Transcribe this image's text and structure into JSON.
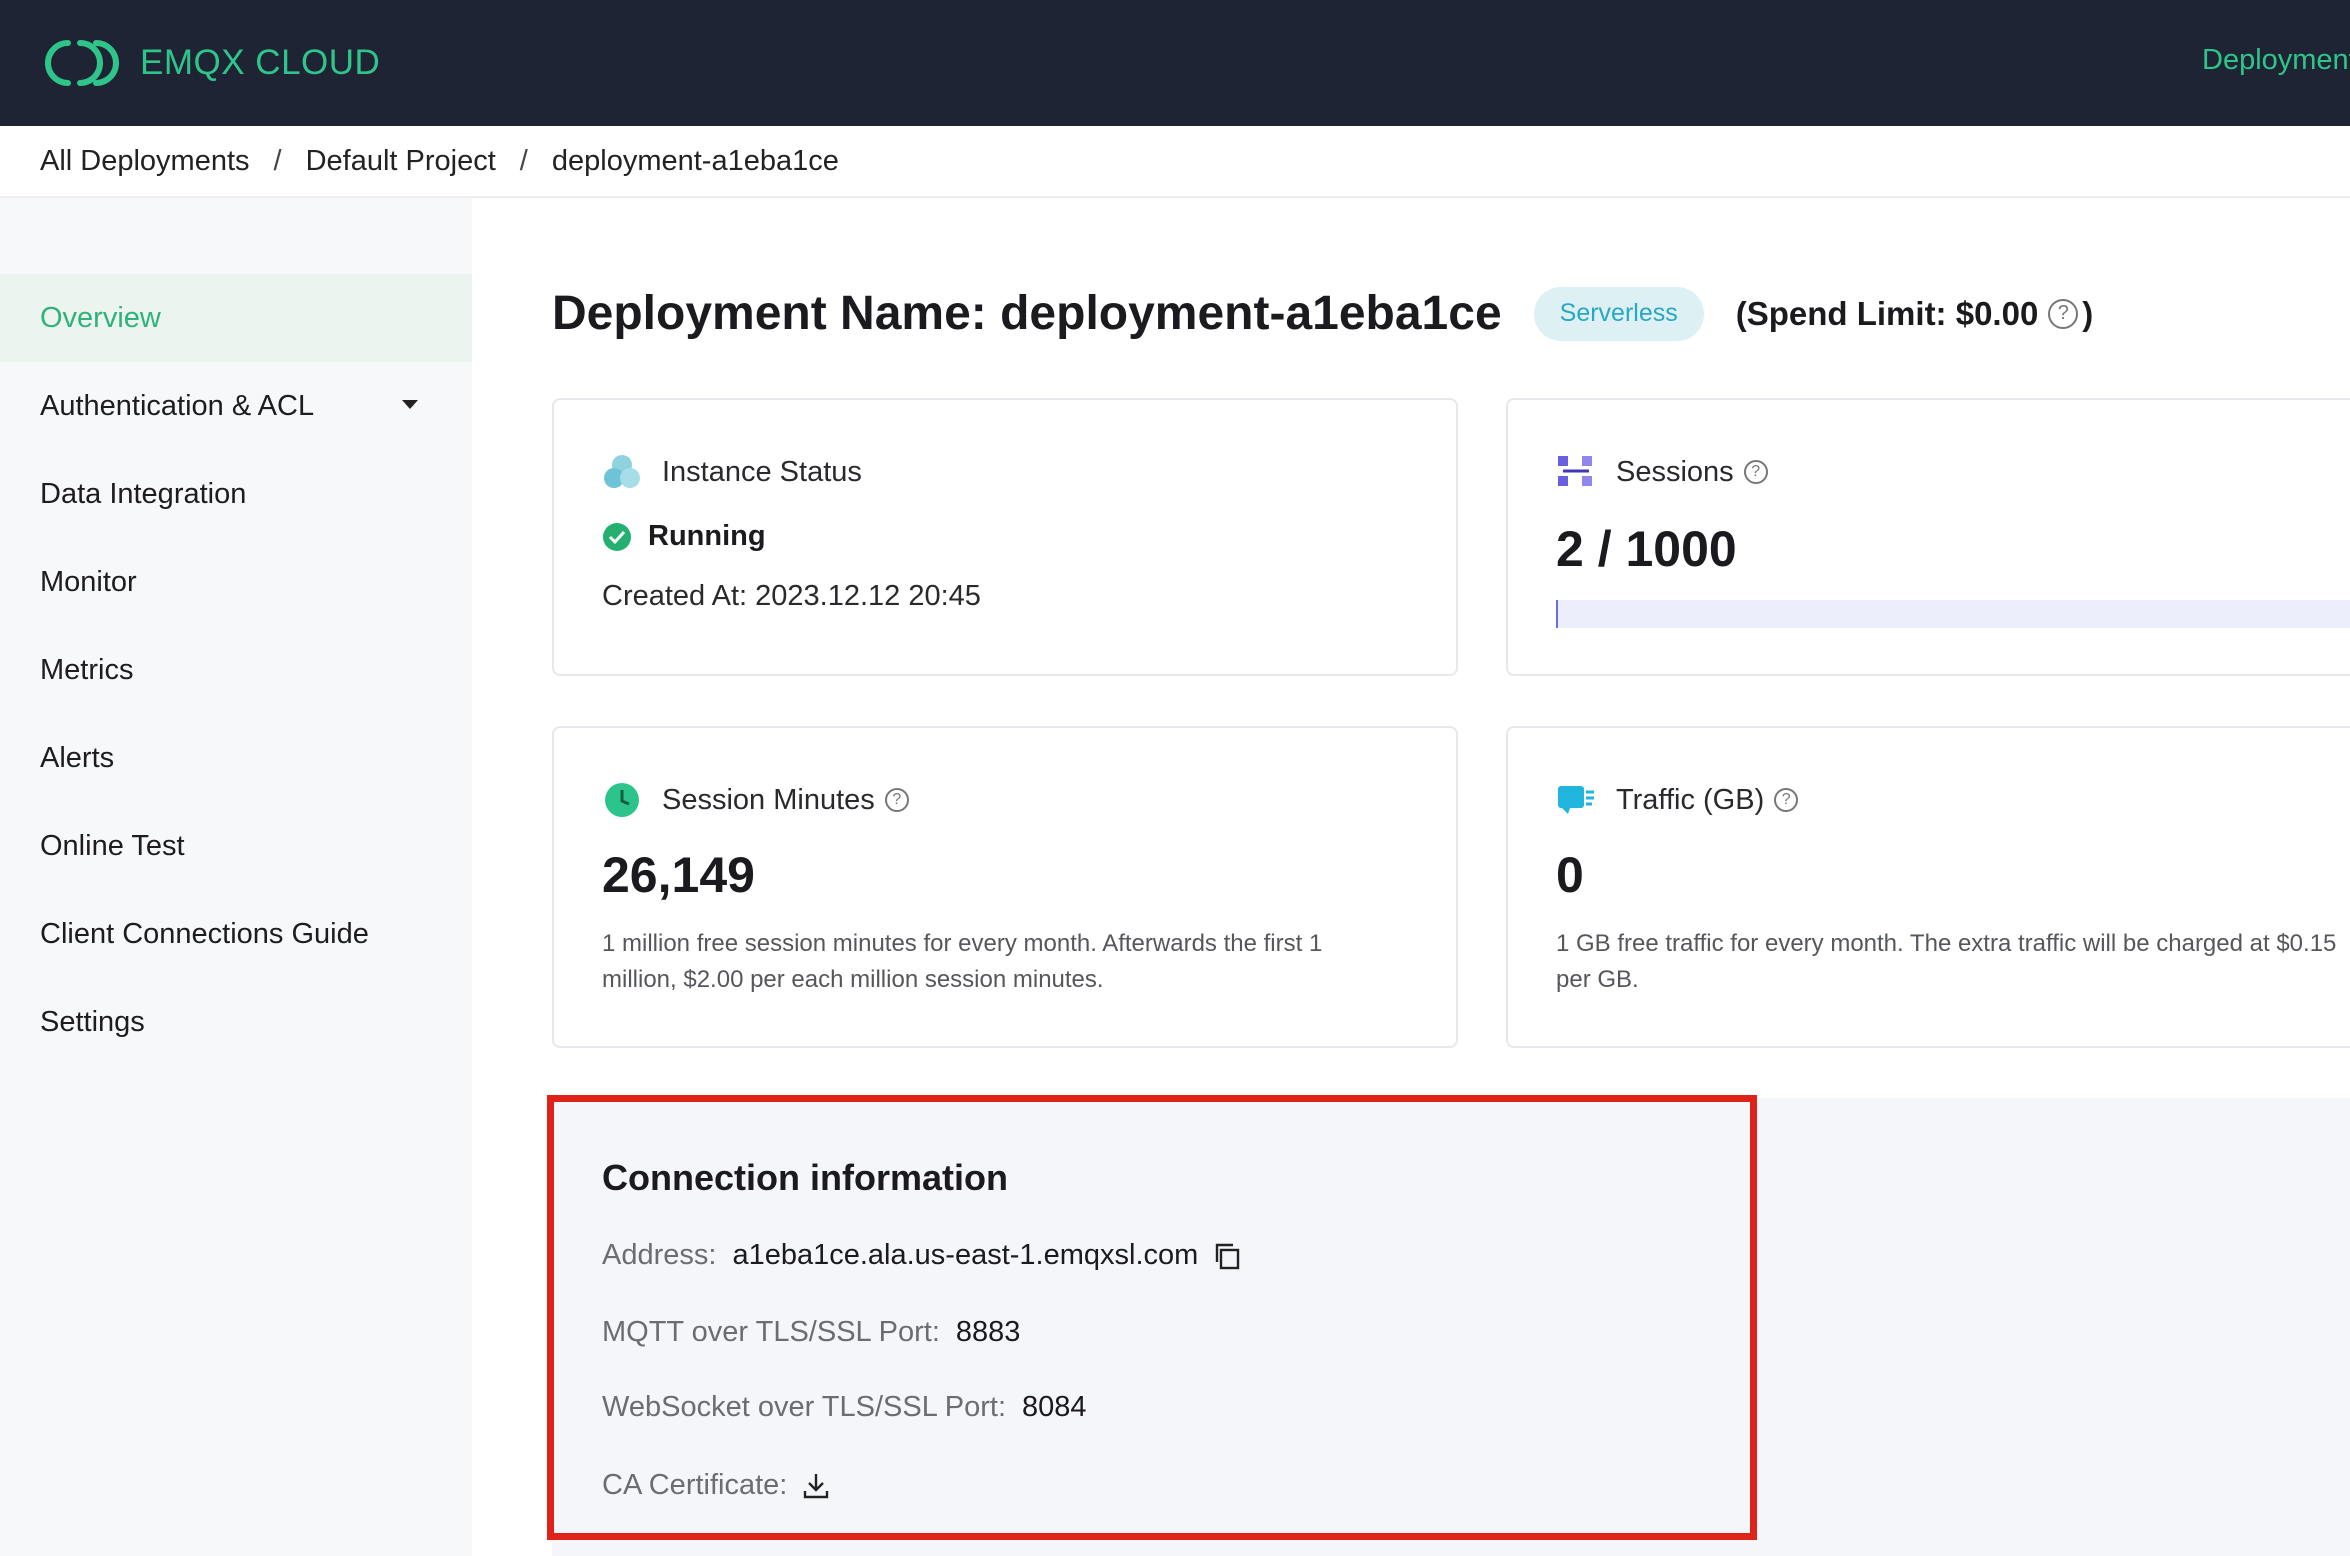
{
  "app": {
    "brand": "EMQX CLOUD",
    "top_nav": "Deployments"
  },
  "breadcrumb": {
    "items": [
      "All Deployments",
      "Default Project",
      "deployment-a1eba1ce"
    ],
    "separator": "/"
  },
  "sidebar": {
    "items": [
      {
        "label": "Overview",
        "active": true
      },
      {
        "label": "Authentication & ACL",
        "expandable": true
      },
      {
        "label": "Data Integration"
      },
      {
        "label": "Monitor"
      },
      {
        "label": "Metrics"
      },
      {
        "label": "Alerts"
      },
      {
        "label": "Online Test"
      },
      {
        "label": "Client Connections Guide"
      },
      {
        "label": "Settings"
      }
    ]
  },
  "header": {
    "title": "Deployment Name: deployment-a1eba1ce",
    "badge": "Serverless",
    "spend_limit": "(Spend Limit: $0.00",
    "spend_close": ")"
  },
  "cards": {
    "instance": {
      "label": "Instance Status",
      "status": "Running",
      "created": "Created At: 2023.12.12 20:45"
    },
    "sessions": {
      "label": "Sessions",
      "value": "2 / 1000",
      "progress_fraction": 0.002
    },
    "session_minutes": {
      "label": "Session Minutes",
      "value": "26,149",
      "description": "1 million free session minutes for every month. Afterwards the first 1 million, $2.00 per each million session minutes."
    },
    "traffic": {
      "label": "Traffic (GB)",
      "value": "0",
      "description": "1 GB free traffic for every month. The extra traffic will be charged at $0.15 per GB."
    }
  },
  "connection": {
    "title": "Connection information",
    "address_label": "Address:",
    "address": "a1eba1ce.ala.us-east-1.emqxsl.com",
    "mqtt_label": "MQTT over TLS/SSL Port:",
    "mqtt_port": "8883",
    "ws_label": "WebSocket over TLS/SSL Port:",
    "ws_port": "8084",
    "ca_label": "CA Certificate:"
  },
  "colors": {
    "brand_green": "#2fc58a",
    "topbar": "#1e2433",
    "highlight_border": "#e0231a",
    "badge_bg": "#ddf0f4"
  }
}
